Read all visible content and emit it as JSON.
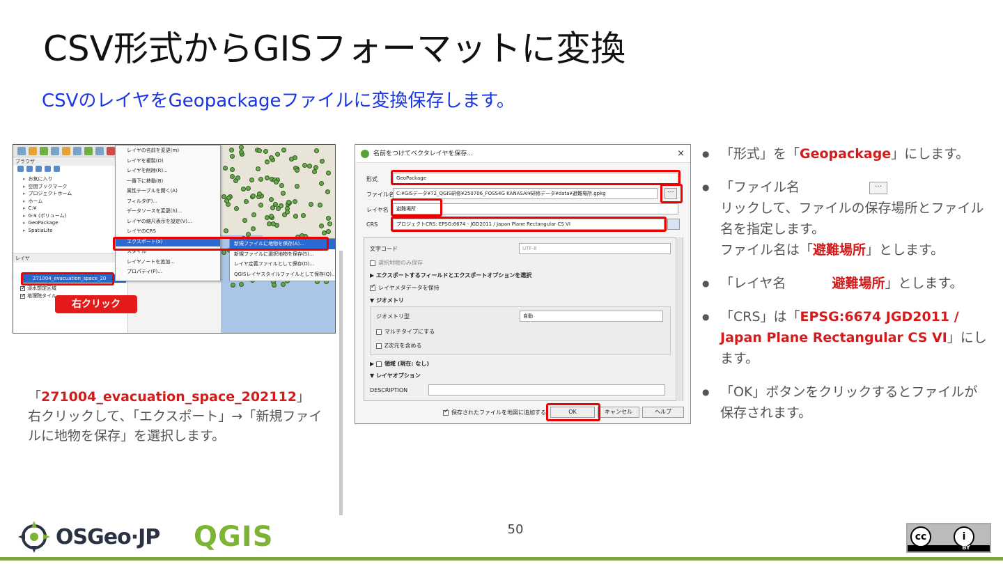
{
  "title": "CSV形式からGISフォーマットに変換",
  "subtitle": "CSVのレイヤをGeopackageファイルに変換保存します。",
  "left_shot": {
    "browser_header": "ブラウザ",
    "tree": [
      "お気に入り",
      "空間ブックマーク",
      "プロジェクトホーム",
      "ホーム",
      "C:¥",
      "G:¥ (ボリューム)",
      "GeoPackage",
      "SpatiaLite"
    ],
    "layers_header": "レイヤ",
    "selected_layer": "271004_evacuation_space_20",
    "layer_rows": [
      "浸水想定区域",
      "地理院タイル"
    ],
    "right_click_label": "右クリック",
    "context_menu": [
      "レイヤの名前を変更(m)",
      "レイヤを複製(D)",
      "レイヤを削除(R)...",
      "一番下に移動(B)",
      "属性テーブルを開く(A)",
      "フィルタ(F)...",
      "データソースを変更(h)...",
      "レイヤの縮尺表示を設定(V)...",
      "レイヤのCRS",
      "エクスポート(x)",
      "スタイル",
      "レイヤノートを追加...",
      "プロパティ(P)..."
    ],
    "submenu": [
      "新規ファイルに地物を保存(A)...",
      "新規ファイルに選択地物を保存(S)...",
      "レイヤ定義ファイルとして保存(D)...",
      "QGISレイヤスタイルファイルとして保存(Q)..."
    ]
  },
  "left_note": {
    "name": "271004_evacuation_space_202112",
    "open_quote": "「",
    "close_quote": "」",
    "body": "右クリックして、「エクスポート」→「新規ファイルに地物を保存」を選択します。"
  },
  "dialog": {
    "title": "名前をつけてベクタレイヤを保存...",
    "close": "×",
    "format_label": "形式",
    "format_value": "GeoPackage",
    "filename_label": "ファイル名",
    "filename_value": "C:¥GISデータ¥72_QGIS研修¥250706_FOSS4G KANASAI¥研修データ¥data¥避難場所.gpkg",
    "ellipsis": "···",
    "layername_label": "レイヤ名",
    "layername_value": "避難場所",
    "crs_label": "CRS",
    "crs_value": "プロジェクトCRS: EPSG:6674 - JGD2011 / Japan Plane Rectangular CS VI",
    "encoding_label": "文字コード",
    "encoding_value": "UTF-8",
    "selected_only": "選択地物のみ保存",
    "export_fields": "エクスポートするフィールドとエクスポートオプションを選択",
    "keep_metadata": "レイヤメタデータを保持",
    "geometry_section": "ジオメトリ",
    "geometry_type_label": "ジオメトリ型",
    "geometry_type_value": "自動",
    "multi_type": "マルチタイプにする",
    "z_dim": "Z次元を含める",
    "extent": "領域 (現在: なし)",
    "layer_options": "レイヤオプション",
    "description_label": "DESCRIPTION",
    "add_to_map": "保存されたファイルを地図に追加する",
    "ok": "OK",
    "cancel": "キャンセル",
    "help": "ヘルプ"
  },
  "bullets": [
    {
      "pre": "「形式」を「",
      "red": "Geopackage",
      "post": "」にします。"
    },
    {
      "pre": "「ファイル名",
      "post": "リックして、ファイルの保存場所とファイル名を指定します。",
      "line2_pre": "ファイル名は「",
      "line2_red": "避難場所",
      "line2_post": "」とします。",
      "ellipsis": "···"
    },
    {
      "pre": "「レイヤ名",
      "red": "避難場所",
      "post": "」とします。"
    },
    {
      "pre": "「CRS」は「",
      "red": "EPSG:6674 JGD2011 / Japan Plane Rectangular CS VI",
      "post": "」にします。"
    },
    {
      "pre": "「OK」ボタンをクリックするとファイルが保存されます。"
    }
  ],
  "footer": {
    "osgeo": "OSGeo·JP",
    "qgis": "QGIS",
    "page": "50",
    "cc_left": "cc",
    "cc_by": "BY",
    "cc_person": "i"
  },
  "colors": {
    "accent_blue": "#1a35e6",
    "highlight_red": "#d41a1a",
    "footer_green": "#7aa43c"
  }
}
